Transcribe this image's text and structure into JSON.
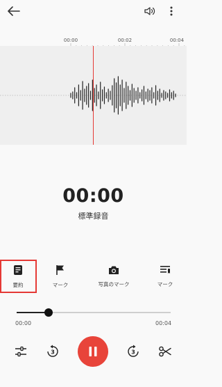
{
  "timeline": {
    "ticks": [
      "00:00",
      "00:02",
      "00:04"
    ]
  },
  "player": {
    "current_time": "00:00",
    "mode_label": "標準録音"
  },
  "toolbar": {
    "items": [
      {
        "label": "要約",
        "icon": "summary-icon"
      },
      {
        "label": "マーク",
        "icon": "flag-icon"
      },
      {
        "label": "写真のマーク",
        "icon": "camera-icon"
      },
      {
        "label": "マーク",
        "icon": "list-mark-icon"
      }
    ]
  },
  "progress": {
    "start": "00:00",
    "end": "00:04",
    "fraction": 0.21
  },
  "colors": {
    "accent": "#e8443a",
    "highlight": "#e53935",
    "playhead": "#e53935"
  }
}
